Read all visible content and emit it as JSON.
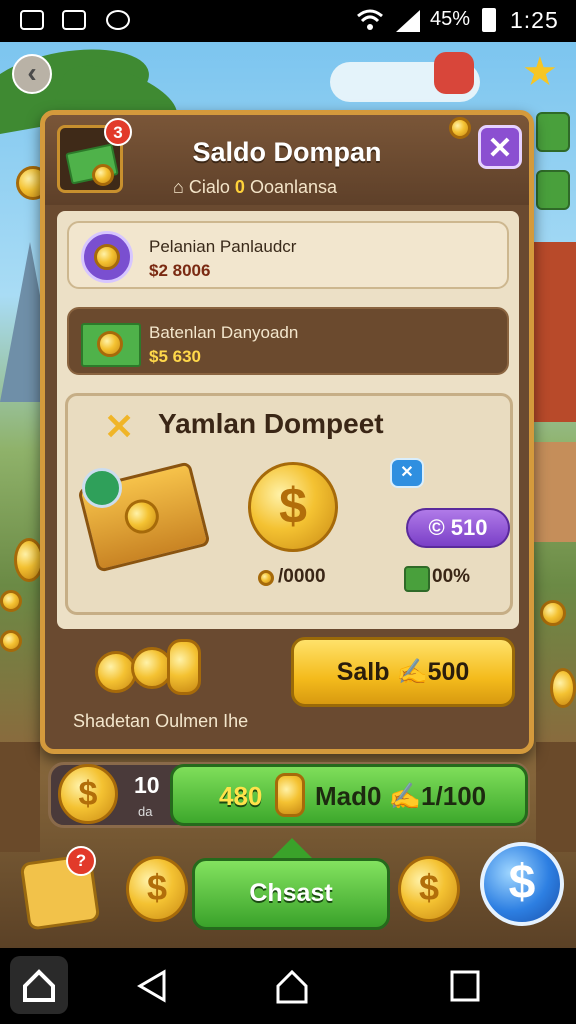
{
  "status_bar": {
    "battery": "45%",
    "time": "1:25"
  },
  "modal": {
    "title": "Saldo Dompan",
    "subtitle_prefix": "Cialo",
    "subtitle_highlight": "0",
    "subtitle_suffix": "Ooanlansa",
    "badge_count": "3",
    "close_label": "✕"
  },
  "rows": [
    {
      "title": "Pelanian Panlaudcr",
      "value": "$2 8006"
    },
    {
      "title": "Batenlan Danyoadn",
      "value": "$5 630"
    }
  ],
  "section": {
    "title": "Yamlan Dompeet",
    "coin_value": "/0000",
    "pill_value": "© 510",
    "pill_x": "✕",
    "percent": "00%"
  },
  "saldo_button": "Salb ✍500",
  "shade_text": "Shadetan Oulmen Ihe",
  "bottom_bar": {
    "count": "10",
    "count_sub": "da",
    "left_value": "480",
    "right_text": "Mad0 ✍1/100"
  },
  "bottom_badge": "?",
  "bottom_green": "Chsast",
  "colors": {
    "accent_gold": "#f4bb1c",
    "accent_green": "#3da82c",
    "accent_purple": "#8b4fd1"
  }
}
